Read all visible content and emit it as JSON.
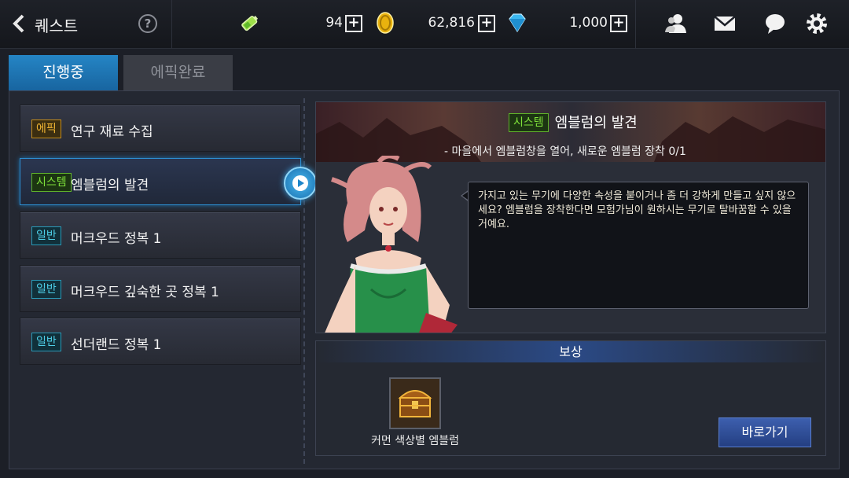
{
  "header": {
    "title": "퀘스트",
    "help_symbol": "?",
    "stamina": {
      "icon": "stamina-battery-icon",
      "value": "94"
    },
    "gold": {
      "icon": "gold-coin-icon",
      "value": "62,816"
    },
    "gems": {
      "icon": "diamond-icon",
      "value": "1,000"
    },
    "plus_symbol": "+"
  },
  "tabs": [
    {
      "label": "진행중",
      "active": true
    },
    {
      "label": "에픽완료",
      "active": false
    }
  ],
  "quests": [
    {
      "type": "epic",
      "badge": "에픽",
      "title": "연구 재료 수집",
      "selected": false
    },
    {
      "type": "system",
      "badge": "시스템",
      "title": "엠블럼의 발견",
      "selected": true
    },
    {
      "type": "normal",
      "badge": "일반",
      "title": "머크우드 정복 1",
      "selected": false
    },
    {
      "type": "normal",
      "badge": "일반",
      "title": "머크우드 깊숙한 곳 정복 1",
      "selected": false
    },
    {
      "type": "normal",
      "badge": "일반",
      "title": "선더랜드 정복 1",
      "selected": false
    }
  ],
  "detail": {
    "badge": "시스템",
    "title": "엠블럼의 발견",
    "objective": "- 마을에서 엠블럼창을 열어, 새로운 엠블럼 장착 0/1",
    "dialogue": "가지고 있는 무기에 다양한 속성을 붙이거나 좀 더 강하게 만들고 싶지 않으세요? 엠블럼을 장착한다면 모험가님이 원하시는 무기로 탈바꿈할 수 있을거예요."
  },
  "reward": {
    "header": "보상",
    "item_name": "커먼 색상별 엠블럼",
    "item_icon": "treasure-chest-icon",
    "goto_label": "바로가기"
  },
  "colors": {
    "accent_blue": "#2585c5",
    "epic": "#f0b533",
    "system": "#7fe13a",
    "normal": "#4ecfe8"
  }
}
